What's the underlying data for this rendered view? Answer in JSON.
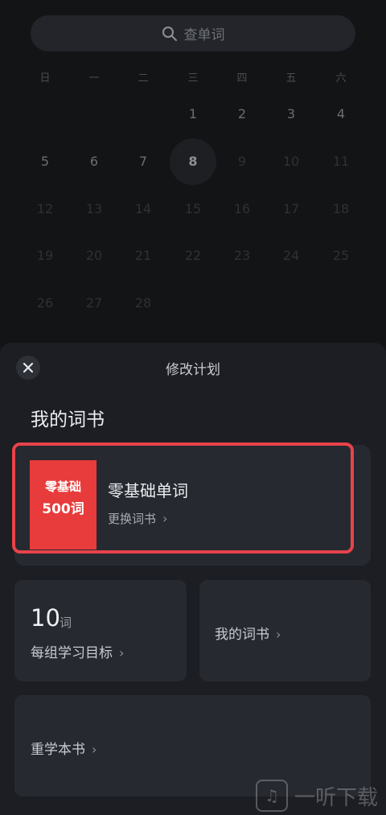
{
  "search": {
    "placeholder": "查单词"
  },
  "calendar": {
    "weekdays": [
      "日",
      "一",
      "二",
      "三",
      "四",
      "五",
      "六"
    ],
    "today": "8",
    "rows": [
      [
        "",
        "",
        "",
        "1",
        "2",
        "3",
        "4"
      ],
      [
        "5",
        "6",
        "7",
        "8",
        "9",
        "10",
        "11"
      ],
      [
        "12",
        "13",
        "14",
        "15",
        "16",
        "17",
        "18"
      ],
      [
        "19",
        "20",
        "21",
        "22",
        "23",
        "24",
        "25"
      ],
      [
        "26",
        "27",
        "28",
        "",
        "",
        "",
        ""
      ]
    ]
  },
  "sheet": {
    "title": "修改计划",
    "section_title": "我的词书",
    "book": {
      "cover_line1": "零基础",
      "cover_line2": "500词",
      "name": "零基础单词",
      "change_label": "更换词书"
    },
    "goal": {
      "number": "10",
      "unit": "词",
      "label": "每组学习目标"
    },
    "my_books_label": "我的词书",
    "relearn_label": "重学本书"
  },
  "watermark": {
    "text": "一听下载"
  },
  "colors": {
    "highlight": "#e8434a",
    "cover": "#e83b3b",
    "card": "#262930"
  }
}
